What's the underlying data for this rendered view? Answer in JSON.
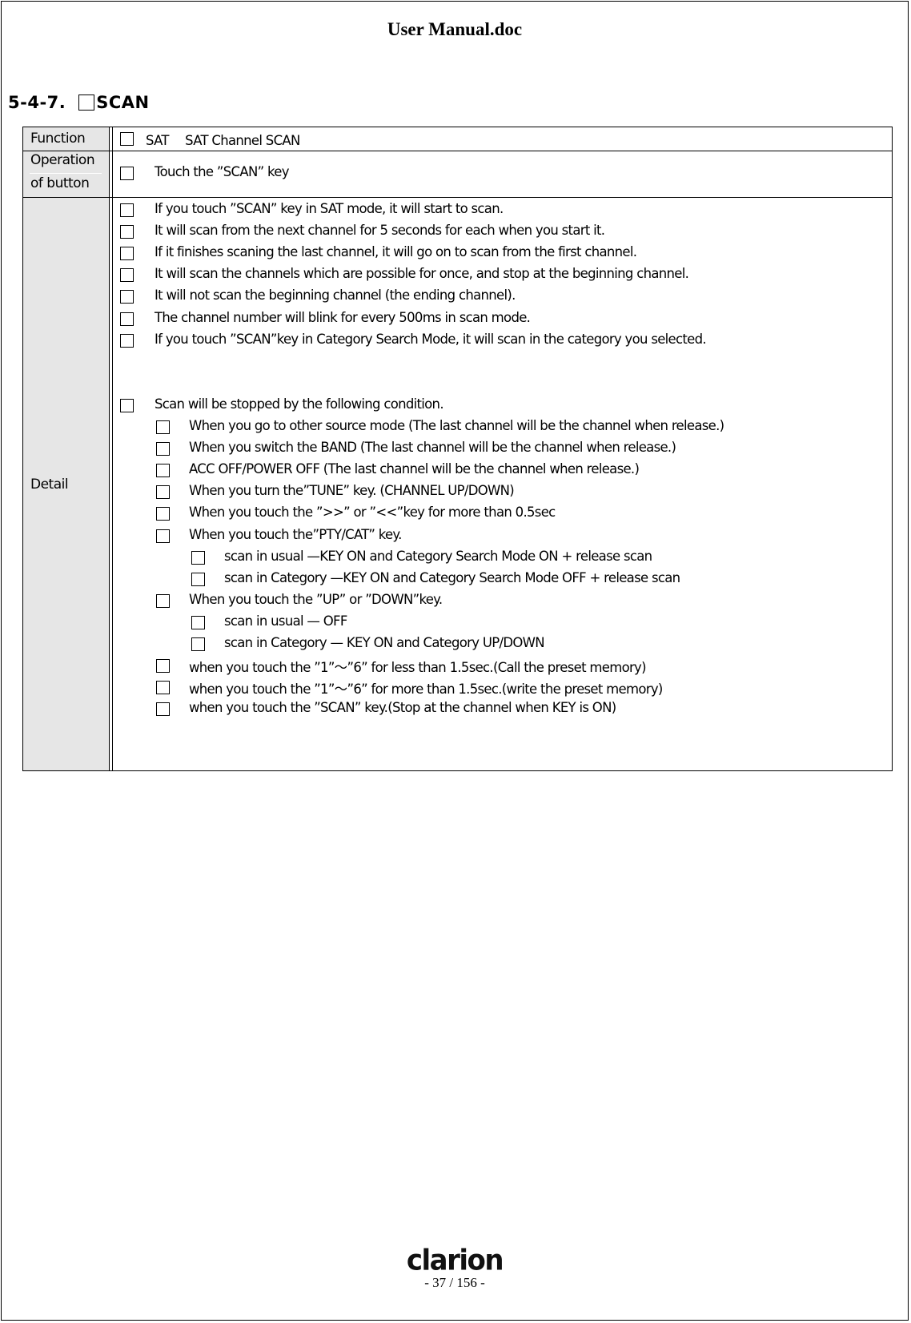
{
  "document": {
    "title": "User Manual.doc",
    "section_number": "5-4-7.",
    "section_title": "SCAN"
  },
  "table": {
    "labels": {
      "function": "Function",
      "operation_line1": "Operation",
      "operation_line2": "of button",
      "detail": "Detail"
    },
    "function_text": "SAT　 SAT Channel SCAN",
    "operation_text": "Touch the ”SCAN” key",
    "detail_items": [
      {
        "level": 0,
        "text": "If you touch ”SCAN” key in SAT mode, it will start to scan."
      },
      {
        "level": 0,
        "text": "It will scan from the next channel for 5 seconds for each when you start it."
      },
      {
        "level": 0,
        "text": "If it finishes scaning the last channel, it will go on to scan from the first channel."
      },
      {
        "level": 0,
        "text": "It will scan the channels which are possible for once, and stop at the beginning channel."
      },
      {
        "level": 0,
        "text": "It will not scan the beginning channel (the ending channel)."
      },
      {
        "level": 0,
        "text": "The channel number will blink for every 500ms in scan mode."
      },
      {
        "level": 0,
        "text": "If you touch ”SCAN”key in Category Search Mode, it will scan in the category you selected."
      },
      {
        "level": 0,
        "text": "Scan will be stopped by the following condition."
      },
      {
        "level": 1,
        "text": "When you go to other source mode (The last channel will be the channel when release.)"
      },
      {
        "level": 1,
        "text": "When you switch the BAND (The last channel will be the channel when release.)"
      },
      {
        "level": 1,
        "text": "ACC OFF/POWER OFF (The last channel will be the channel when release.)"
      },
      {
        "level": 1,
        "text": "When you turn the”TUNE” key. (CHANNEL UP/DOWN)"
      },
      {
        "level": 1,
        "text": "When you touch the ”>>” or ”<<”key for more than 0.5sec"
      },
      {
        "level": 1,
        "text": "When you touch the”PTY/CAT” key."
      },
      {
        "level": 2,
        "text": "scan in usual —KEY ON and Category Search Mode ON + release scan"
      },
      {
        "level": 2,
        "text": "scan in Category —KEY ON and Category Search Mode OFF + release scan"
      },
      {
        "level": 1,
        "text": "When you touch the ”UP” or ”DOWN”key."
      },
      {
        "level": 2,
        "text": "scan in usual — OFF"
      },
      {
        "level": 2,
        "text": "scan in Category — KEY ON and Category UP/DOWN"
      },
      {
        "level": 1,
        "text": "when you touch the ”1”～”6” for less than 1.5sec.(Call the preset memory)"
      },
      {
        "level": 1,
        "text": "when you touch the ”1”～”6” for more than 1.5sec.(write the preset memory)"
      },
      {
        "level": 1,
        "text": "when you touch the ”SCAN” key.(Stop at the channel when KEY is ON)"
      }
    ]
  },
  "footer": {
    "logo_text": "clarion",
    "page_number": "- 37 / 156 -"
  }
}
